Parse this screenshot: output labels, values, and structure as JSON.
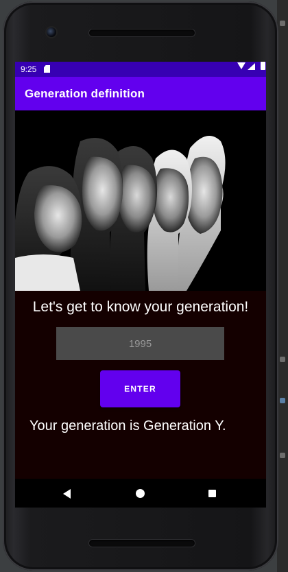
{
  "status_bar": {
    "time": "9:25",
    "icons": [
      "sd-card-icon",
      "wifi-icon",
      "signal-icon",
      "battery-icon"
    ]
  },
  "app_bar": {
    "title": "Generation definition"
  },
  "hero_image": {
    "icon": "generations-photo"
  },
  "form": {
    "prompt": "Let's get to know your generation!",
    "year_input_value": "1995",
    "enter_label": "ENTER",
    "result": "Your generation is Generation Y."
  },
  "nav_bar": {
    "icons": [
      "back-icon",
      "home-icon",
      "recents-icon"
    ]
  },
  "colors": {
    "status_bar": "#3700b3",
    "app_bar": "#6200ee",
    "button": "#6200ee",
    "panel": "#140000",
    "input_bg": "#4a4a4a"
  }
}
